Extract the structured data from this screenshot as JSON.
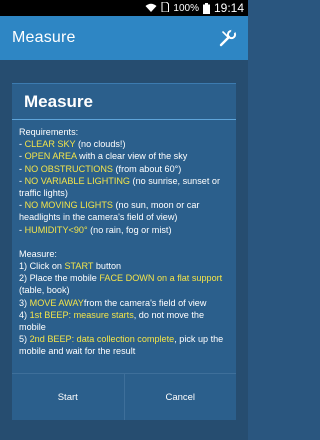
{
  "status": {
    "battery": "100%",
    "time": "19:14"
  },
  "app": {
    "title": "Measure"
  },
  "dialog": {
    "title": "Measure",
    "requirements_heading": "Requirements:",
    "req1": {
      "dash": "- ",
      "hl": "CLEAR SKY",
      "rest": " (no clouds!)"
    },
    "req2": {
      "dash": "- ",
      "hl": "OPEN AREA",
      "rest": " with a clear view of the sky"
    },
    "req3": {
      "dash": "- ",
      "hl": "NO OBSTRUCTIONS",
      "rest": " (from about 60°)"
    },
    "req4": {
      "dash": "- ",
      "hl": "NO VARIABLE LIGHTING",
      "rest": " (no sunrise, sunset or traffic lights)"
    },
    "req5": {
      "dash": "- ",
      "hl": "NO MOVING LIGHTS",
      "rest": " (no sun, moon or car headlights in the camera's field of view)"
    },
    "req6": {
      "dash": "- ",
      "hl": "HUMIDITY<90°",
      "rest": " (no rain, fog or mist)"
    },
    "measure_heading": "Measure:",
    "step1": {
      "pre": "1) Click on ",
      "hl": "START",
      "rest": " button"
    },
    "step2": {
      "pre": "2) Place the mobile ",
      "hl": "FACE DOWN on a flat support",
      "rest": " (table, book)"
    },
    "step3": {
      "pre": "3) ",
      "hl": "MOVE AWAY",
      "rest": "from the camera's field of view"
    },
    "step4": {
      "pre": "4) ",
      "hl": "1st BEEP: measure starts",
      "rest": ", do not move the mobile"
    },
    "step5": {
      "pre": "5) ",
      "hl": "2nd BEEP: data collection complete",
      "rest": ", pick up the mobile and wait for the result"
    },
    "start_label": "Start",
    "cancel_label": "Cancel"
  }
}
